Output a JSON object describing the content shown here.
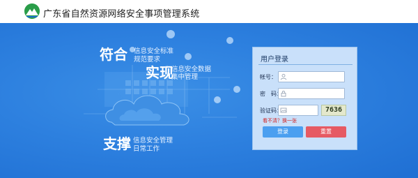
{
  "header": {
    "title": "广东省自然资源网络安全事项管理系统",
    "logo_icon": "mountain-logo-icon"
  },
  "hero": {
    "blocks": [
      {
        "big": "符合",
        "lines": [
          "信息安全标准",
          "规范要求"
        ]
      },
      {
        "big": "实现",
        "lines": [
          "信息安全数据",
          "集中管理"
        ]
      },
      {
        "big": "支撑",
        "lines": [
          "信息安全管理",
          "日常工作"
        ]
      }
    ]
  },
  "login": {
    "title": "用户登录",
    "username_label": "帐号：",
    "username_value": "",
    "password_label": "密　码：",
    "password_value": "",
    "captcha_label": "验证码：",
    "captcha_value": "",
    "captcha_text": "7636",
    "refresh_text": "看不清？换一张",
    "login_button": "登录",
    "reset_button": "重置"
  },
  "colors": {
    "hero_blue": "#2d80df",
    "login_button": "#4b9ff0",
    "reset_button": "#e65a63",
    "refresh_text": "#d11f1f"
  }
}
